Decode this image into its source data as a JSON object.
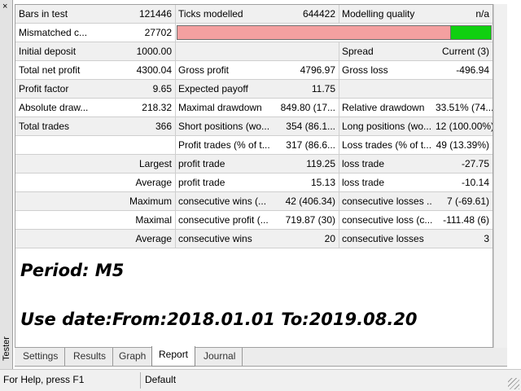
{
  "window": {
    "side_label": "Tester",
    "close_glyph": "×"
  },
  "report": {
    "rows": [
      {
        "c1": "Bars in test",
        "c2": "121446",
        "c3": "Ticks modelled",
        "c4": "644422",
        "c5": "Modelling quality",
        "c6": "n/a"
      },
      {
        "c1": "Mismatched c...",
        "c2": "27702",
        "quality_bar": {
          "red_fraction": 0.87,
          "green_fraction": 0.13
        }
      },
      {
        "c1": "Initial deposit",
        "c2": "1000.00",
        "c3": "",
        "c4": "",
        "c5": "Spread",
        "c6": "Current (3)"
      },
      {
        "c1": "Total net profit",
        "c2": "4300.04",
        "c3": "Gross profit",
        "c4": "4796.97",
        "c5": "Gross loss",
        "c6": "-496.94"
      },
      {
        "c1": "Profit factor",
        "c2": "9.65",
        "c3": "Expected payoff",
        "c4": "11.75",
        "c5": "",
        "c6": ""
      },
      {
        "c1": "Absolute draw...",
        "c2": "218.32",
        "c3": "Maximal drawdown",
        "c4": "849.80 (17...",
        "c5": "Relative drawdown",
        "c6": "33.51% (74..."
      },
      {
        "c1": "Total trades",
        "c2": "366",
        "c3": "Short positions (wo...",
        "c4": "354 (86.1...",
        "c5": "Long positions (wo...",
        "c6": "12 (100.00%)"
      },
      {
        "c12": "",
        "c3": "Profit trades (% of t...",
        "c4": "317 (86.6...",
        "c5": "Loss trades (% of t...",
        "c6": "49 (13.39%)"
      },
      {
        "c12": "Largest",
        "c3": "profit trade",
        "c4": "119.25",
        "c5": "loss trade",
        "c6": "-27.75"
      },
      {
        "c12": "Average",
        "c3": "profit trade",
        "c4": "15.13",
        "c5": "loss trade",
        "c6": "-10.14"
      },
      {
        "c12": "Maximum",
        "c3": "consecutive wins (...",
        "c4": "42 (406.34)",
        "c5": "consecutive losses ...",
        "c6": "7 (-69.61)"
      },
      {
        "c12": "Maximal",
        "c3": "consecutive profit (...",
        "c4": "719.87 (30)",
        "c5": "consecutive loss (c...",
        "c6": "-111.48 (6)"
      },
      {
        "c12": "Average",
        "c3": "consecutive wins",
        "c4": "20",
        "c5": "consecutive losses",
        "c6": "3"
      }
    ]
  },
  "overlay": {
    "period": "Period: M5",
    "use_date": "Use date:From:2018.01.01 To:2019.08.20"
  },
  "tabs": [
    "Settings",
    "Results",
    "Graph",
    "Report",
    "Journal"
  ],
  "active_tab": "Report",
  "status": {
    "help": "For Help, press F1",
    "profile": "Default"
  },
  "colors": {
    "quality_red": "#f4a0a0",
    "quality_green": "#10d010",
    "row_alt": "#f0f0f0"
  }
}
